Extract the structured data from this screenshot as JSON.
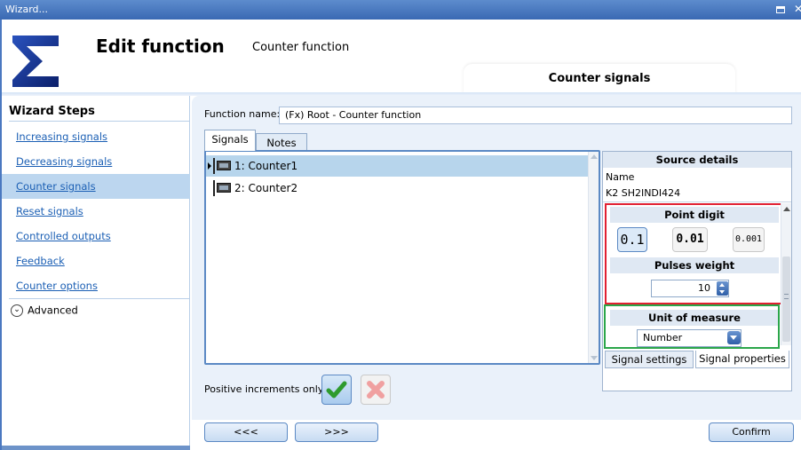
{
  "window": {
    "title": "Wizard..."
  },
  "header": {
    "title": "Edit function",
    "subtitle": "Counter function",
    "step_tab": "Counter signals"
  },
  "sidebar": {
    "title": "Wizard Steps",
    "steps": [
      {
        "label": "Increasing signals"
      },
      {
        "label": "Decreasing signals"
      },
      {
        "label": "Counter signals"
      },
      {
        "label": "Reset signals"
      },
      {
        "label": "Controlled outputs"
      },
      {
        "label": "Feedback"
      },
      {
        "label": "Counter options"
      }
    ],
    "advanced": "Advanced"
  },
  "function": {
    "label": "Function name:",
    "value": "(Fx) Root - Counter function"
  },
  "tabs": {
    "signals": "Signals",
    "notes": "Notes"
  },
  "signals": [
    {
      "label": "1: Counter1"
    },
    {
      "label": "2: Counter2"
    }
  ],
  "source": {
    "title": "Source details",
    "name_label": "Name",
    "name_value": "K2 SH2INDI424"
  },
  "point_digit": {
    "title": "Point digit",
    "options": [
      "0.1",
      "0.01",
      "0.001"
    ],
    "selected": "0.1"
  },
  "pulses_weight": {
    "title": "Pulses weight",
    "value": "10"
  },
  "unit_of_measure": {
    "title": "Unit of measure",
    "value": "Number"
  },
  "right_tabs": {
    "settings": "Signal settings",
    "properties": "Signal properties"
  },
  "positive": {
    "label": "Positive increments only"
  },
  "nav": {
    "prev": "<<<",
    "next": ">>>",
    "confirm": "Confirm"
  },
  "colors": {
    "accent": "#3a69b3",
    "selected_row": "#b7d5ec",
    "red_highlight": "#e12032",
    "green_highlight": "#2ba64a"
  }
}
